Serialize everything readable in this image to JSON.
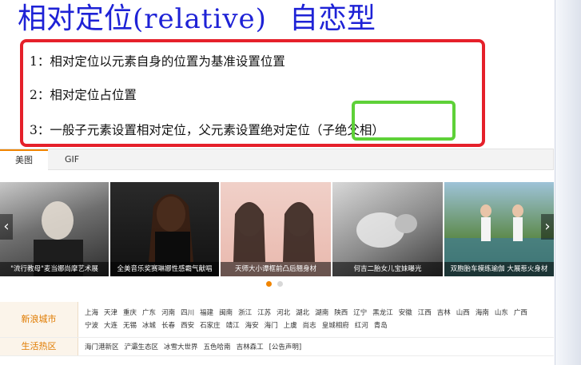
{
  "slide": {
    "title_part1": "相对定位",
    "title_part2": "(relative)",
    "title_part3": "自恋型",
    "points": [
      "1：相对定位以元素自身的位置为基准设置位置",
      "2：相对定位占位置",
      "3：一般子元素设置相对定位，父元素设置绝对定位（子绝父相）"
    ]
  },
  "tabs": [
    "美图",
    "GIF"
  ],
  "gallery": {
    "prev_arrow": "‹",
    "next_arrow": "›",
    "captions": [
      "\"流行教母\"麦当娜尚摩艺术展",
      "全美音乐奖赛琳娜性感霸气献唱",
      "天师大小谭框前凸后翘身材",
      "何吉二胎女儿宝妹曝光",
      "双胞胎车模练瑜伽 大展惹火身材"
    ]
  },
  "city": {
    "label_cities": "新浪城市",
    "label_hot": "生活热区",
    "row1": [
      "上海",
      "天津",
      "重庆",
      "广东",
      "河南",
      "四川",
      "福建",
      "闽南",
      "浙江",
      "江苏",
      "河北",
      "湖北",
      "湖南",
      "陕西",
      "辽宁",
      "黑龙江",
      "安徽",
      "江西",
      "吉林",
      "山西",
      "海南",
      "山东",
      "广西"
    ],
    "row2": [
      "宁波",
      "大连",
      "无锡",
      "冰城",
      "长春",
      "西安",
      "石家庄",
      "靖江",
      "海安",
      "海门",
      "上虞",
      "尚志",
      "皇城相府",
      "红河",
      "青岛"
    ],
    "row3": [
      "海门港新区",
      "浐灞生态区",
      "冰雪大世界",
      "五色哈南",
      "吉林森工",
      "[公告声明]"
    ]
  },
  "colors": {
    "title_blue": "#1e22d6",
    "box_red": "#e5202a",
    "box_green": "#5ed138",
    "accent_orange": "#f08400"
  }
}
